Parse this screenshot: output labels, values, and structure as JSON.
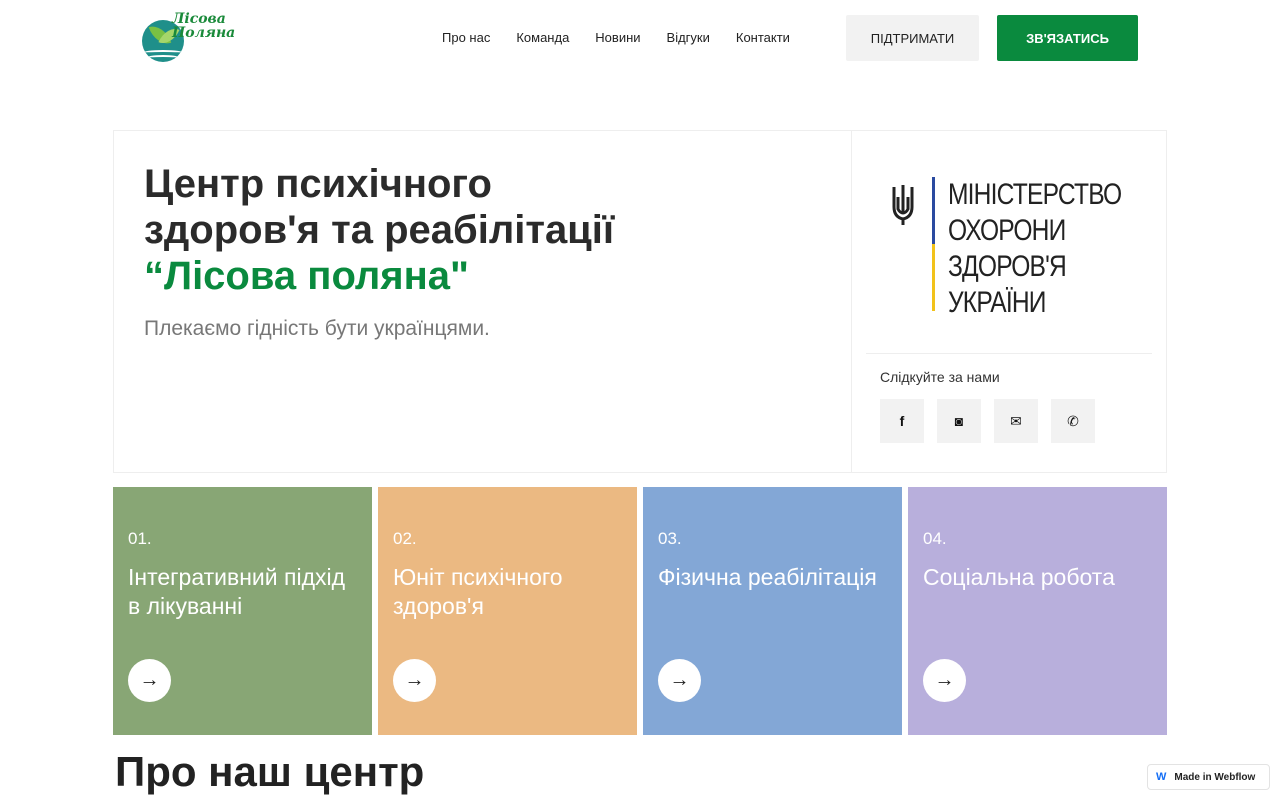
{
  "header": {
    "logo_line1": "Лісова",
    "logo_line2": "Поляна",
    "nav": [
      "Про нас",
      "Команда",
      "Новини",
      "Відгуки",
      "Контакти"
    ],
    "support_label": "ПІДТРИМАТИ",
    "contact_label": "ЗВ'ЯЗАТИСЬ"
  },
  "hero": {
    "title_line1": "Центр психічного",
    "title_line2": "здоров'я та реабілітації",
    "title_highlight": "“Лісова поляна\"",
    "subtitle": "Плекаємо гідність бути українцями.",
    "ministry_lines": [
      "МІНІСТЕРСТВО",
      "ОХОРОНИ",
      "ЗДОРОВ'Я",
      "УКРАЇНИ"
    ],
    "follow_label": "Слідкуйте за нами",
    "socials": [
      {
        "icon": "facebook-icon",
        "glyph": "f"
      },
      {
        "icon": "instagram-icon",
        "glyph": "◙"
      },
      {
        "icon": "mail-icon",
        "glyph": "✉"
      },
      {
        "icon": "phone-icon",
        "glyph": "✆"
      }
    ]
  },
  "cards": [
    {
      "num": "01.",
      "title": "Інтегративний підхід в лікуванні",
      "color": "#88a675"
    },
    {
      "num": "02.",
      "title": "Юніт психічного здоров'я",
      "color": "#ebb982"
    },
    {
      "num": "03.",
      "title": "Фізична реабілітація",
      "color": "#83a7d6"
    },
    {
      "num": "04.",
      "title": "Соціальна робота",
      "color": "#b8afdc"
    }
  ],
  "arrow_glyph": "→",
  "section_title": "Про наш центр",
  "badge": {
    "icon": "webflow-icon",
    "glyph": "W",
    "label": "Made in Webflow"
  },
  "colors": {
    "accent": "#0a8a3e",
    "support_bg": "#f2f2f2"
  }
}
